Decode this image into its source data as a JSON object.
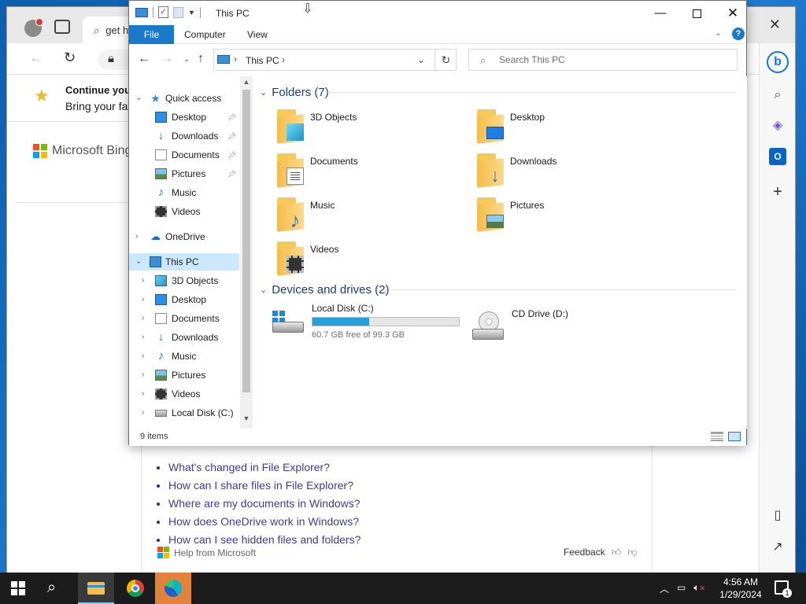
{
  "edge": {
    "tab_title": "get h",
    "banner_title": "Continue your",
    "banner_text": "Bring your fav",
    "bing_label": "Microsoft Bing",
    "faq": [
      "What's changed in File Explorer?",
      "How can I share files in File Explorer?",
      "Where are my documents in Windows?",
      "How does OneDrive work in Windows?",
      "How can I see hidden files and folders?"
    ],
    "help_label": "Help from Microsoft",
    "feedback_label": "Feedback"
  },
  "explorer": {
    "title": "This PC",
    "ribbon_tabs": [
      "File",
      "Computer",
      "View"
    ],
    "address": "This PC",
    "search_placeholder": "Search This PC",
    "nav_tree": [
      {
        "label": "Quick access",
        "icon": "quick-access-star-icon",
        "level": 0,
        "expanded": true
      },
      {
        "label": "Desktop",
        "icon": "desktop-icon",
        "level": 1,
        "pinned": true
      },
      {
        "label": "Downloads",
        "icon": "download-arrow-icon",
        "level": 1,
        "pinned": true
      },
      {
        "label": "Documents",
        "icon": "document-icon",
        "level": 1,
        "pinned": true
      },
      {
        "label": "Pictures",
        "icon": "picture-icon",
        "level": 1,
        "pinned": true
      },
      {
        "label": "Music",
        "icon": "music-note-icon",
        "level": 1
      },
      {
        "label": "Videos",
        "icon": "video-film-icon",
        "level": 1
      },
      {
        "label": "OneDrive",
        "icon": "onedrive-cloud-icon",
        "level": 0
      },
      {
        "label": "This PC",
        "icon": "this-pc-monitor-icon",
        "level": 0,
        "expanded": true,
        "selected": true
      },
      {
        "label": "3D Objects",
        "icon": "3d-objects-cube-icon",
        "level": 1
      },
      {
        "label": "Desktop",
        "icon": "desktop-icon",
        "level": 1
      },
      {
        "label": "Documents",
        "icon": "document-icon",
        "level": 1
      },
      {
        "label": "Downloads",
        "icon": "download-arrow-icon",
        "level": 1
      },
      {
        "label": "Music",
        "icon": "music-note-icon",
        "level": 1
      },
      {
        "label": "Pictures",
        "icon": "picture-icon",
        "level": 1
      },
      {
        "label": "Videos",
        "icon": "video-film-icon",
        "level": 1
      },
      {
        "label": "Local Disk (C:)",
        "icon": "local-disk-icon",
        "level": 1
      }
    ],
    "folders_header": "Folders (7)",
    "folders": [
      {
        "name": "3D Objects",
        "icon": "3d-objects-folder-icon"
      },
      {
        "name": "Desktop",
        "icon": "desktop-folder-icon"
      },
      {
        "name": "Documents",
        "icon": "documents-folder-icon"
      },
      {
        "name": "Downloads",
        "icon": "downloads-folder-icon"
      },
      {
        "name": "Music",
        "icon": "music-folder-icon"
      },
      {
        "name": "Pictures",
        "icon": "pictures-folder-icon"
      },
      {
        "name": "Videos",
        "icon": "videos-folder-icon"
      }
    ],
    "drives_header": "Devices and drives (2)",
    "drives": [
      {
        "name": "Local Disk (C:)",
        "free_text": "60.7 GB free of 99.3 GB",
        "used_fraction": 0.389
      },
      {
        "name": "CD Drive (D:)"
      }
    ],
    "status_items": "9 items"
  },
  "taskbar": {
    "time": "4:56 AM",
    "date": "1/29/2024",
    "notification_count": "1"
  },
  "colors": {
    "accent": "#1979ca",
    "selection": "#cce8ff",
    "drive_bar": "#26a0da",
    "link": "#3d3b9a"
  }
}
